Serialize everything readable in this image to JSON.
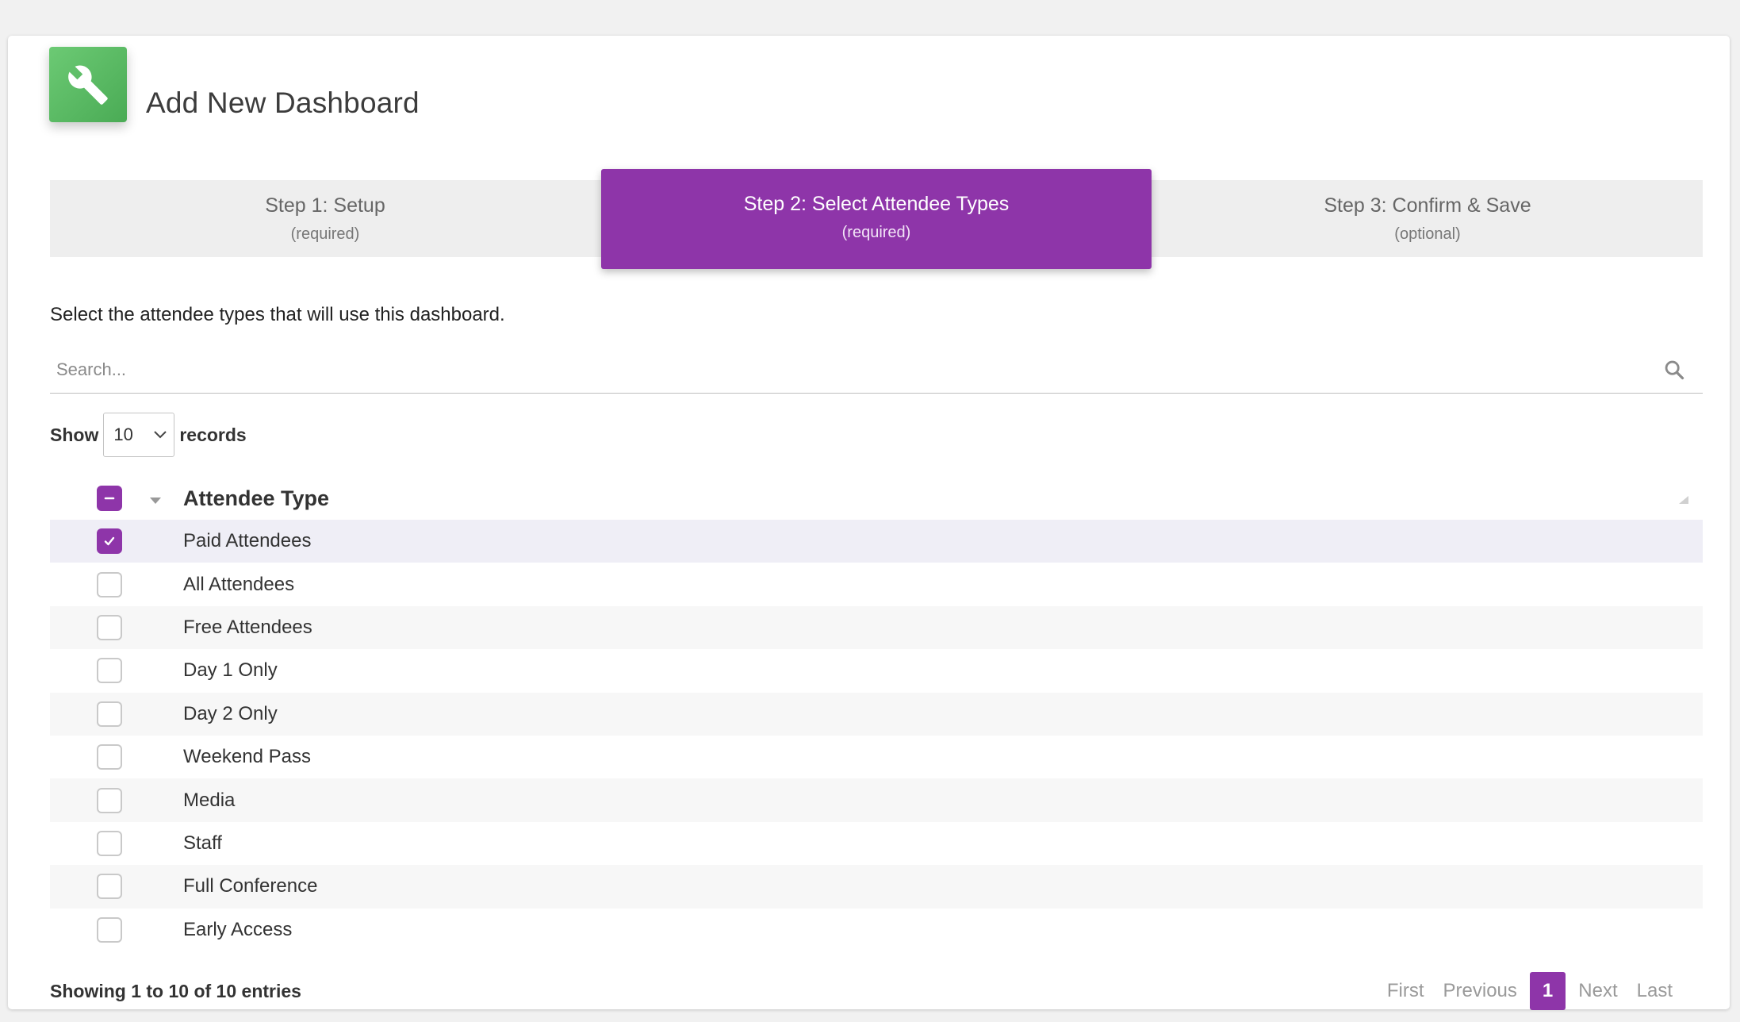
{
  "header": {
    "title": "Add New Dashboard",
    "icon": "wrench-icon",
    "icon_color": "#5bb864"
  },
  "steps": [
    {
      "title": "Step 1: Setup",
      "sub": "(required)"
    },
    {
      "title": "Step 2: Select Attendee Types",
      "sub": "(required)"
    },
    {
      "title": "Step 3: Confirm & Save",
      "sub": "(optional)"
    }
  ],
  "active_step_color": "#8e35a9",
  "instructions": "Select the attendee types that will use this dashboard.",
  "search": {
    "placeholder": "Search...",
    "value": ""
  },
  "length": {
    "show_label": "Show",
    "value": "10",
    "records_label": "records"
  },
  "table": {
    "column": "Attendee Type",
    "header_checkbox": "indeterminate",
    "rows": [
      {
        "label": "Paid Attendees",
        "checked": true
      },
      {
        "label": "All Attendees",
        "checked": false
      },
      {
        "label": "Free Attendees",
        "checked": false
      },
      {
        "label": "Day 1 Only",
        "checked": false
      },
      {
        "label": "Day 2 Only",
        "checked": false
      },
      {
        "label": "Weekend Pass",
        "checked": false
      },
      {
        "label": "Media",
        "checked": false
      },
      {
        "label": "Staff",
        "checked": false
      },
      {
        "label": "Full Conference",
        "checked": false
      },
      {
        "label": "Early Access",
        "checked": false
      }
    ]
  },
  "footer": {
    "info": "Showing 1 to 10 of 10 entries",
    "pager": {
      "first": "First",
      "previous": "Previous",
      "current": "1",
      "next": "Next",
      "last": "Last"
    }
  }
}
